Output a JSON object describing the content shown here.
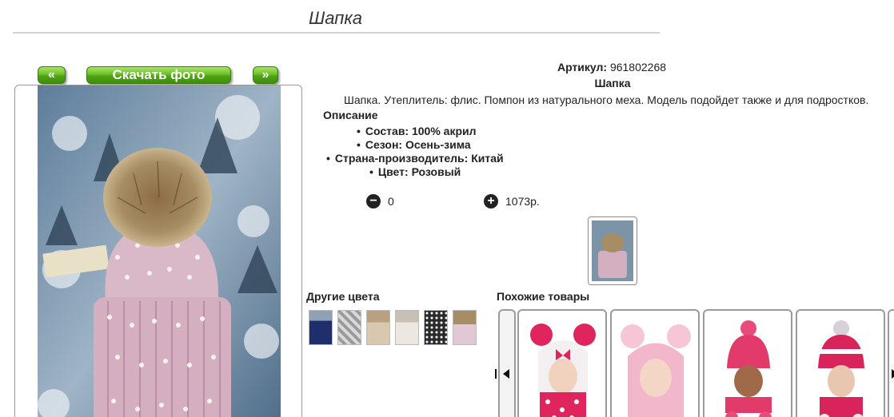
{
  "page": {
    "title": "Шапка"
  },
  "photo_controls": {
    "prev_label": "«",
    "download_label": "Скачать фото",
    "next_label": "»"
  },
  "product": {
    "article_label": "Артикул:",
    "article_value": "961802268",
    "name": "Шапка",
    "description": "Шапка. Утеплитель: флис. Помпон из натурального меха. Модель подойдет также и для подростков.",
    "description_heading": "Описание",
    "specs": [
      "Состав: 100% акрил",
      "Сезон: Осень-зима",
      "Страна-производитель: Китай",
      "Цвет: Розовый"
    ]
  },
  "cart": {
    "minus_icon": "minus-icon",
    "quantity": "0",
    "plus_icon": "plus-icon",
    "price": "1073р."
  },
  "other_colors": {
    "label": "Другие цвета",
    "swatches": [
      "navy",
      "grey-check",
      "beige",
      "cream",
      "black-sparkle",
      "pink"
    ]
  },
  "similar": {
    "label": "Похожие товары",
    "prev_icon": "first-page-icon",
    "next_icon": "next-page-icon"
  },
  "colors": {
    "button_green": "#5cb31c",
    "border": "#9a9a9a",
    "rule": "#d2d2d2"
  }
}
